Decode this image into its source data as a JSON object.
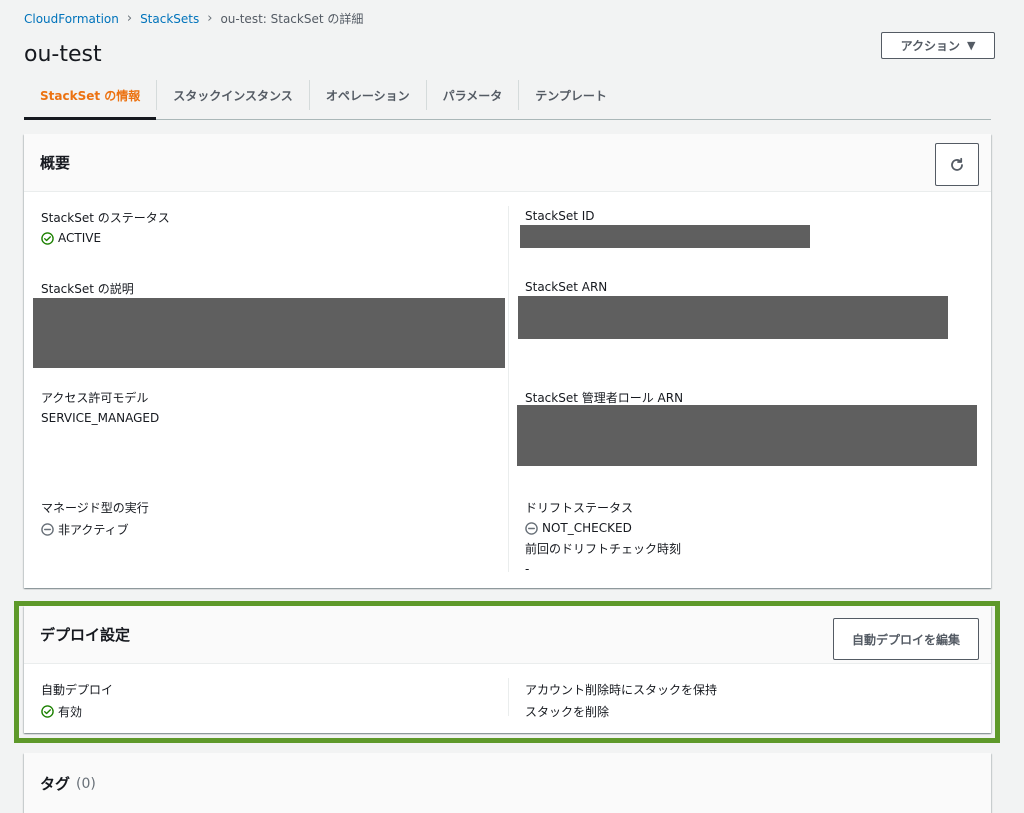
{
  "breadcrumb": {
    "items": [
      "CloudFormation",
      "StackSets"
    ],
    "current": "ou-test: StackSet の詳細"
  },
  "page": {
    "title": "ou-test"
  },
  "actions_button": {
    "label": "アクション"
  },
  "tabs": [
    {
      "label": "StackSet の情報",
      "active": true
    },
    {
      "label": "スタックインスタンス"
    },
    {
      "label": "オペレーション"
    },
    {
      "label": "パラメータ"
    },
    {
      "label": "テンプレート"
    }
  ],
  "overview": {
    "title": "概要",
    "fields": {
      "status_label": "StackSet のステータス",
      "status_value": "ACTIVE",
      "id_label": "StackSet ID",
      "description_label": "StackSet の説明",
      "arn_label": "StackSet ARN",
      "permission_model_label": "アクセス許可モデル",
      "permission_model_value": "SERVICE_MANAGED",
      "admin_role_label": "StackSet 管理者ロール ARN",
      "managed_exec_label": "マネージド型の実行",
      "managed_exec_value": "非アクティブ",
      "drift_status_label": "ドリフトステータス",
      "drift_status_value": "NOT_CHECKED",
      "last_drift_label": "前回のドリフトチェック時刻",
      "last_drift_value": "-"
    }
  },
  "deploy_settings": {
    "title": "デプロイ設定",
    "edit_button": "自動デプロイを編集",
    "auto_deploy_label": "自動デプロイ",
    "auto_deploy_value": "有効",
    "retain_label": "アカウント削除時にスタックを保持",
    "retain_value": "スタックを削除"
  },
  "tags": {
    "title": "タグ",
    "count": "(0)"
  },
  "colors": {
    "link": "#0073bb",
    "active_tab": "#ec7211",
    "success": "#1d8102",
    "highlight_frame": "#5e992a",
    "redaction": "#5f5f5f"
  }
}
